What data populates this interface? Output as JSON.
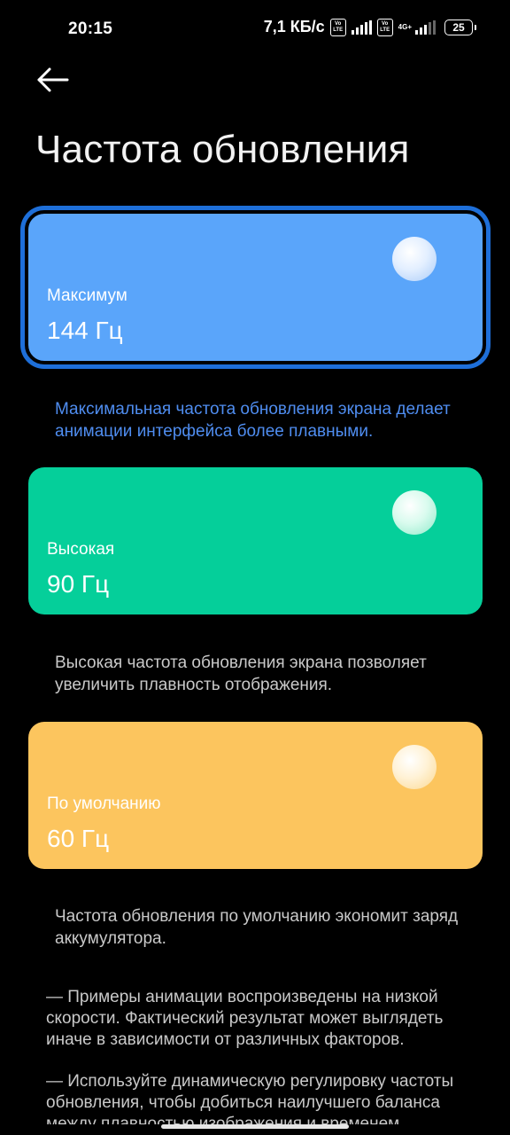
{
  "status_bar": {
    "time": "20:15",
    "net_speed": "7,1 КБ/с",
    "volte_label_top": "Vo",
    "volte_label_bottom": "LTE",
    "network_type": "4G+",
    "battery_level": "25"
  },
  "page": {
    "title": "Частота обновления"
  },
  "options": [
    {
      "name": "Максимум",
      "value": "144 Гц",
      "selected": true,
      "color": "#5aa5fa",
      "description": "Максимальная частота обновления экрана делает анимации интерфейса более плавными."
    },
    {
      "name": "Высокая",
      "value": "90 Гц",
      "selected": false,
      "color": "#05cf9a",
      "description": "Высокая частота обновления экрана позволяет увеличить плавность отображения."
    },
    {
      "name": "По умолчанию",
      "value": "60 Гц",
      "selected": false,
      "color": "#fcc55e",
      "description": "Частота обновления по умолчанию экономит заряд аккумулятора."
    }
  ],
  "notes": [
    "— Примеры анимации воспроизведены на низкой скорости. Фактический результат может выглядеть иначе в зависимости от различных факторов.",
    "— Используйте динамическую регулировку частоты обновления, чтобы добиться наилучшего баланса между плавностью изображения и временем"
  ],
  "colors": {
    "background": "#000000",
    "selection_outline": "#1e6fd9",
    "active_description": "#4f8df0"
  },
  "icons": {
    "back": "arrow-left-icon"
  }
}
